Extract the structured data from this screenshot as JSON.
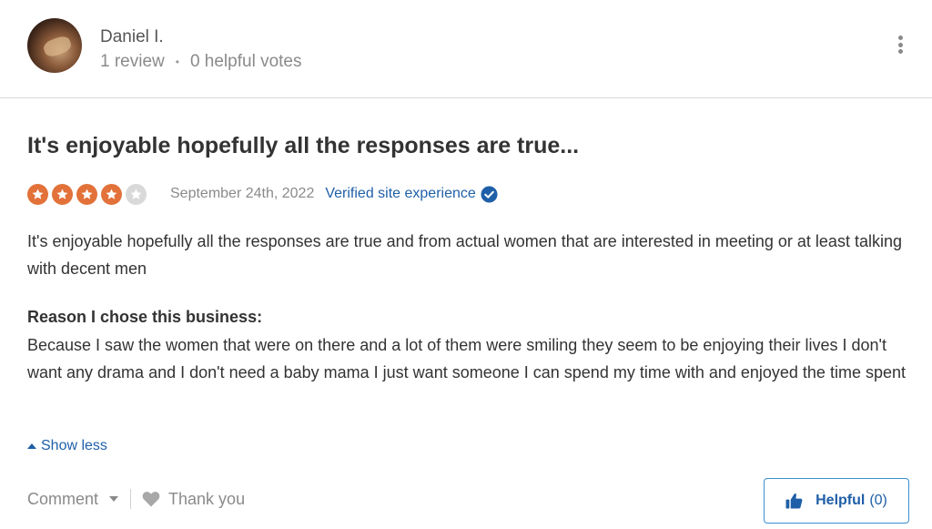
{
  "reviewer": {
    "name": "Daniel I.",
    "review_count": "1 review",
    "separator": "•",
    "helpful_votes": "0 helpful votes"
  },
  "review": {
    "title": "It's enjoyable hopefully all the responses are true...",
    "rating": 4,
    "rating_max": 5,
    "star_color_on": "#e2723a",
    "star_color_off": "#d9d9d9",
    "date": "September 24th, 2022",
    "verified_label": "Verified site experience",
    "body": "It's enjoyable hopefully all the responses are true and from actual women that are interested in meeting or at least talking with decent men",
    "reason_label": "Reason I chose this business:",
    "reason_text": "Because I saw the women that were on there and a lot of them were smiling they seem to be enjoying their lives I don't want any drama and I don't need a baby mama I just want someone I can spend my time with and enjoyed the time spent"
  },
  "actions": {
    "show_less": "Show less",
    "comment": "Comment",
    "thank_you": "Thank you",
    "helpful_label": "Helpful",
    "helpful_count": "(0)"
  },
  "colors": {
    "link": "#1f5fa8",
    "accent_border": "#3a8fd0",
    "muted_text": "#8a8a8a"
  },
  "icons": {
    "more": "more-vertical-icon",
    "verified": "verified-check-icon",
    "star": "star-icon",
    "caret_up": "caret-up-icon",
    "chevron_down": "chevron-down-icon",
    "heart": "heart-icon",
    "thumbs_up": "thumbs-up-icon"
  }
}
